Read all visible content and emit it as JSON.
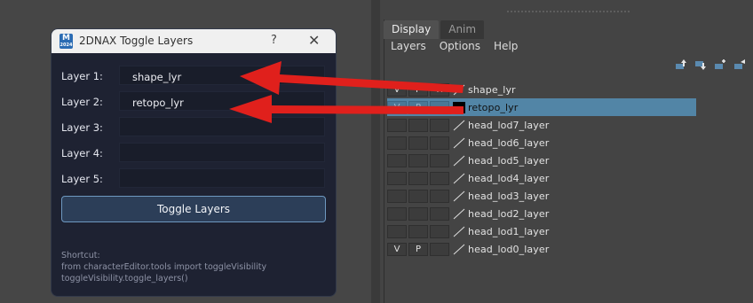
{
  "dialog": {
    "title": "2DNAX Toggle Layers",
    "app_icon": {
      "letter": "M",
      "sub": "2024"
    },
    "help": "?",
    "close": "✕",
    "fields": [
      {
        "label": "Layer 1:",
        "value": "shape_lyr"
      },
      {
        "label": "Layer 2:",
        "value": "retopo_lyr"
      },
      {
        "label": "Layer 3:",
        "value": ""
      },
      {
        "label": "Layer 4:",
        "value": ""
      },
      {
        "label": "Layer 5:",
        "value": ""
      }
    ],
    "button_label": "Toggle Layers",
    "shortcut": {
      "heading": "Shortcut:",
      "line1": "from characterEditor.tools import toggleVisibility",
      "line2": "toggleVisibility.toggle_layers()"
    }
  },
  "layer_editor": {
    "tabs": [
      {
        "label": "Display"
      },
      {
        "label": "Anim"
      }
    ],
    "menu": [
      {
        "label": "Layers"
      },
      {
        "label": "Options"
      },
      {
        "label": "Help"
      }
    ],
    "toolbar_icons": [
      "move-layer-up-icon",
      "move-layer-down-icon",
      "new-layer-icon",
      "new-layer-from-selected-icon"
    ],
    "rows": [
      {
        "v": "V",
        "p": "P",
        "r": "R",
        "name": "shape_lyr",
        "selected": false
      },
      {
        "v": "V",
        "p": "P",
        "r": "",
        "name": "retopo_lyr",
        "selected": true
      },
      {
        "v": "",
        "p": "",
        "r": "",
        "name": "head_lod7_layer",
        "selected": false
      },
      {
        "v": "",
        "p": "",
        "r": "",
        "name": "head_lod6_layer",
        "selected": false
      },
      {
        "v": "",
        "p": "",
        "r": "",
        "name": "head_lod5_layer",
        "selected": false
      },
      {
        "v": "",
        "p": "",
        "r": "",
        "name": "head_lod4_layer",
        "selected": false
      },
      {
        "v": "",
        "p": "",
        "r": "",
        "name": "head_lod3_layer",
        "selected": false
      },
      {
        "v": "",
        "p": "",
        "r": "",
        "name": "head_lod2_layer",
        "selected": false
      },
      {
        "v": "",
        "p": "",
        "r": "",
        "name": "head_lod1_layer",
        "selected": false
      },
      {
        "v": "V",
        "p": "P",
        "r": "",
        "name": "head_lod0_layer",
        "selected": false
      }
    ]
  },
  "colors": {
    "dialog_bg": "#1e2232",
    "button_border": "#6e98c0",
    "selection": "#5285a6",
    "annotation_arrow": "#e0201c"
  }
}
